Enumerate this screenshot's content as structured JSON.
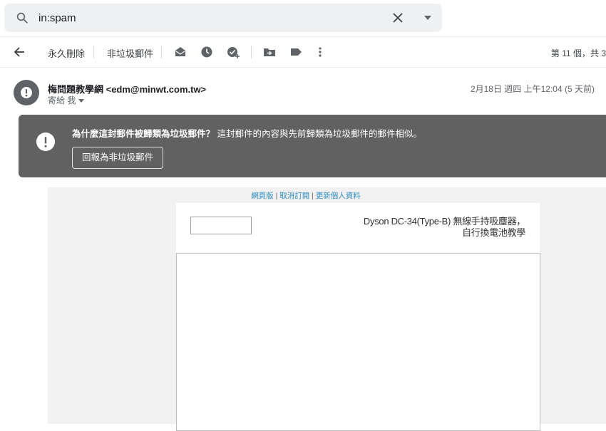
{
  "search": {
    "query": "in:spam"
  },
  "toolbar": {
    "delete_forever": "永久刪除",
    "not_spam": "非垃圾郵件",
    "pager": "第 11 個，共 3"
  },
  "message": {
    "sender": "梅問題教學網 <edm@minwt.com.tw>",
    "recipient": "寄給 我",
    "datetime": "2月18日 週四 上午12:04 (5 天前)"
  },
  "spam_warning": {
    "question": "為什麼這封郵件被歸類為垃圾郵件？",
    "reason": " 這封郵件的內容與先前歸類為垃圾郵件的郵件相似。",
    "report_button": "回報為非垃圾郵件"
  },
  "email_body": {
    "link_web": "網頁版",
    "link_unsubscribe": "取消訂閱",
    "link_update": "更新個人資料",
    "link_sep": " | ",
    "title_line1": "Dyson DC-34(Type-B) 無線手持吸塵器，",
    "title_line2": "自行換電池教學"
  },
  "colors": {
    "warning_bg": "#616161",
    "link": "#2a8ac0",
    "search_bg": "#eef0f2"
  }
}
